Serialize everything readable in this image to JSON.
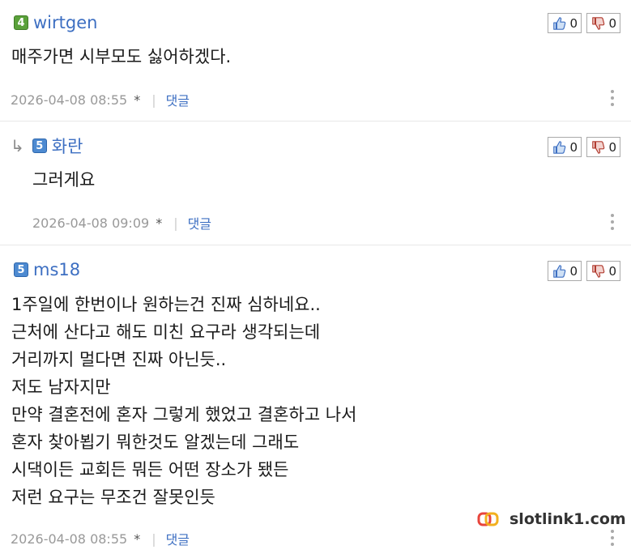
{
  "comments": [
    {
      "level": "4",
      "nickname": "wirtgen",
      "likes": "0",
      "dislikes": "0",
      "text": "매주가면 시부모도 싫어하겠다.",
      "date": "2026-04-08 08:55",
      "star": "*",
      "separator": "|",
      "reply_label": "댓글"
    },
    {
      "level": "5",
      "nickname": "화란",
      "likes": "0",
      "dislikes": "0",
      "text": "그러게요",
      "date": "2026-04-08 09:09",
      "star": "*",
      "separator": "|",
      "reply_label": "댓글"
    },
    {
      "level": "5",
      "nickname": "ms18",
      "likes": "0",
      "dislikes": "0",
      "text": "1주일에 한번이나 원하는건 진짜 심하네요..\n근처에 산다고 해도 미친 요구라 생각되는데\n거리까지 멀다면 진짜 아닌듯..\n저도 남자지만\n만약 결혼전에 혼자 그렇게 했었고 결혼하고 나서\n혼자 찾아뵙기 뭐한것도 알겠는데 그래도\n시댁이든 교회든 뭐든 어떤 장소가 됐든\n저런 요구는 무조건 잘못인듯",
      "date": "2026-04-08 08:55",
      "star": "*",
      "separator": "|",
      "reply_label": "댓글"
    }
  ],
  "watermark": {
    "text": "slotlink1.com"
  },
  "colors": {
    "nickname": "#3d6fc2",
    "level4": "#5aa13a",
    "level5": "#4d8ad1",
    "dislike": "#c0392b"
  },
  "icons": {
    "like": "thumbs-up-icon",
    "dislike": "thumbs-down-icon",
    "more": "more-vertical-icon",
    "reply": "reply-arrow-icon"
  }
}
